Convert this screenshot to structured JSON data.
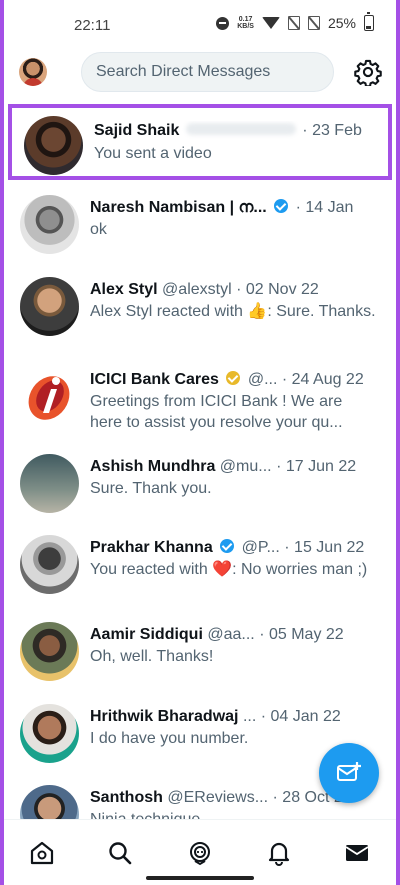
{
  "status_bar": {
    "time": "22:11",
    "net_speed_value": "0.17",
    "net_speed_unit": "KB/S",
    "battery": "25%"
  },
  "header": {
    "search_placeholder": "Search Direct Messages"
  },
  "conversations": [
    {
      "name": "Sajid Shaik",
      "handle": "",
      "date": "23 Feb",
      "message": "You sent a video",
      "verified": "none",
      "highlighted": true
    },
    {
      "name": "Naresh Nambisan | ന...",
      "handle": "",
      "date": "14 Jan",
      "message": "ok",
      "verified": "blue"
    },
    {
      "name": "Alex Styl",
      "handle": "@alexstyl",
      "date": "02 Nov 22",
      "message": "Alex Styl reacted with 👍: Sure. Thanks.",
      "verified": "none"
    },
    {
      "name": "ICICI Bank Cares",
      "handle": "@...",
      "date": "24 Aug 22",
      "message": "Greetings from ICICI Bank ! We are here to assist you resolve your qu...",
      "verified": "gold"
    },
    {
      "name": "Ashish Mundhra",
      "handle": "@mu...",
      "date": "17 Jun 22",
      "message": "Sure. Thank you.",
      "verified": "none"
    },
    {
      "name": "Prakhar Khanna",
      "handle": "@P...",
      "date": "15 Jun 22",
      "message": "You reacted with ❤️: No worries man ;)",
      "verified": "blue"
    },
    {
      "name": "Aamir Siddiqui",
      "handle": "@aa...",
      "date": "05 May 22",
      "message": "Oh, well. Thanks!",
      "verified": "none"
    },
    {
      "name": "Hrithwik Bharadwaj",
      "handle": "...",
      "date": "04 Jan 22",
      "message": "I do have you number.",
      "verified": "none"
    },
    {
      "name": "Santhosh",
      "handle": "@EReviews...",
      "date": "28 Oct 2",
      "message": "Ninja technique",
      "verified": "none"
    }
  ],
  "colors": {
    "highlight": "#a450e6",
    "accent": "#1d9bf0",
    "text_primary": "#0f1419",
    "text_secondary": "#536471"
  },
  "icons": {
    "fab": "new-message-icon",
    "nav": [
      "home-icon",
      "search-icon",
      "spaces-icon",
      "notifications-icon",
      "messages-icon"
    ]
  }
}
